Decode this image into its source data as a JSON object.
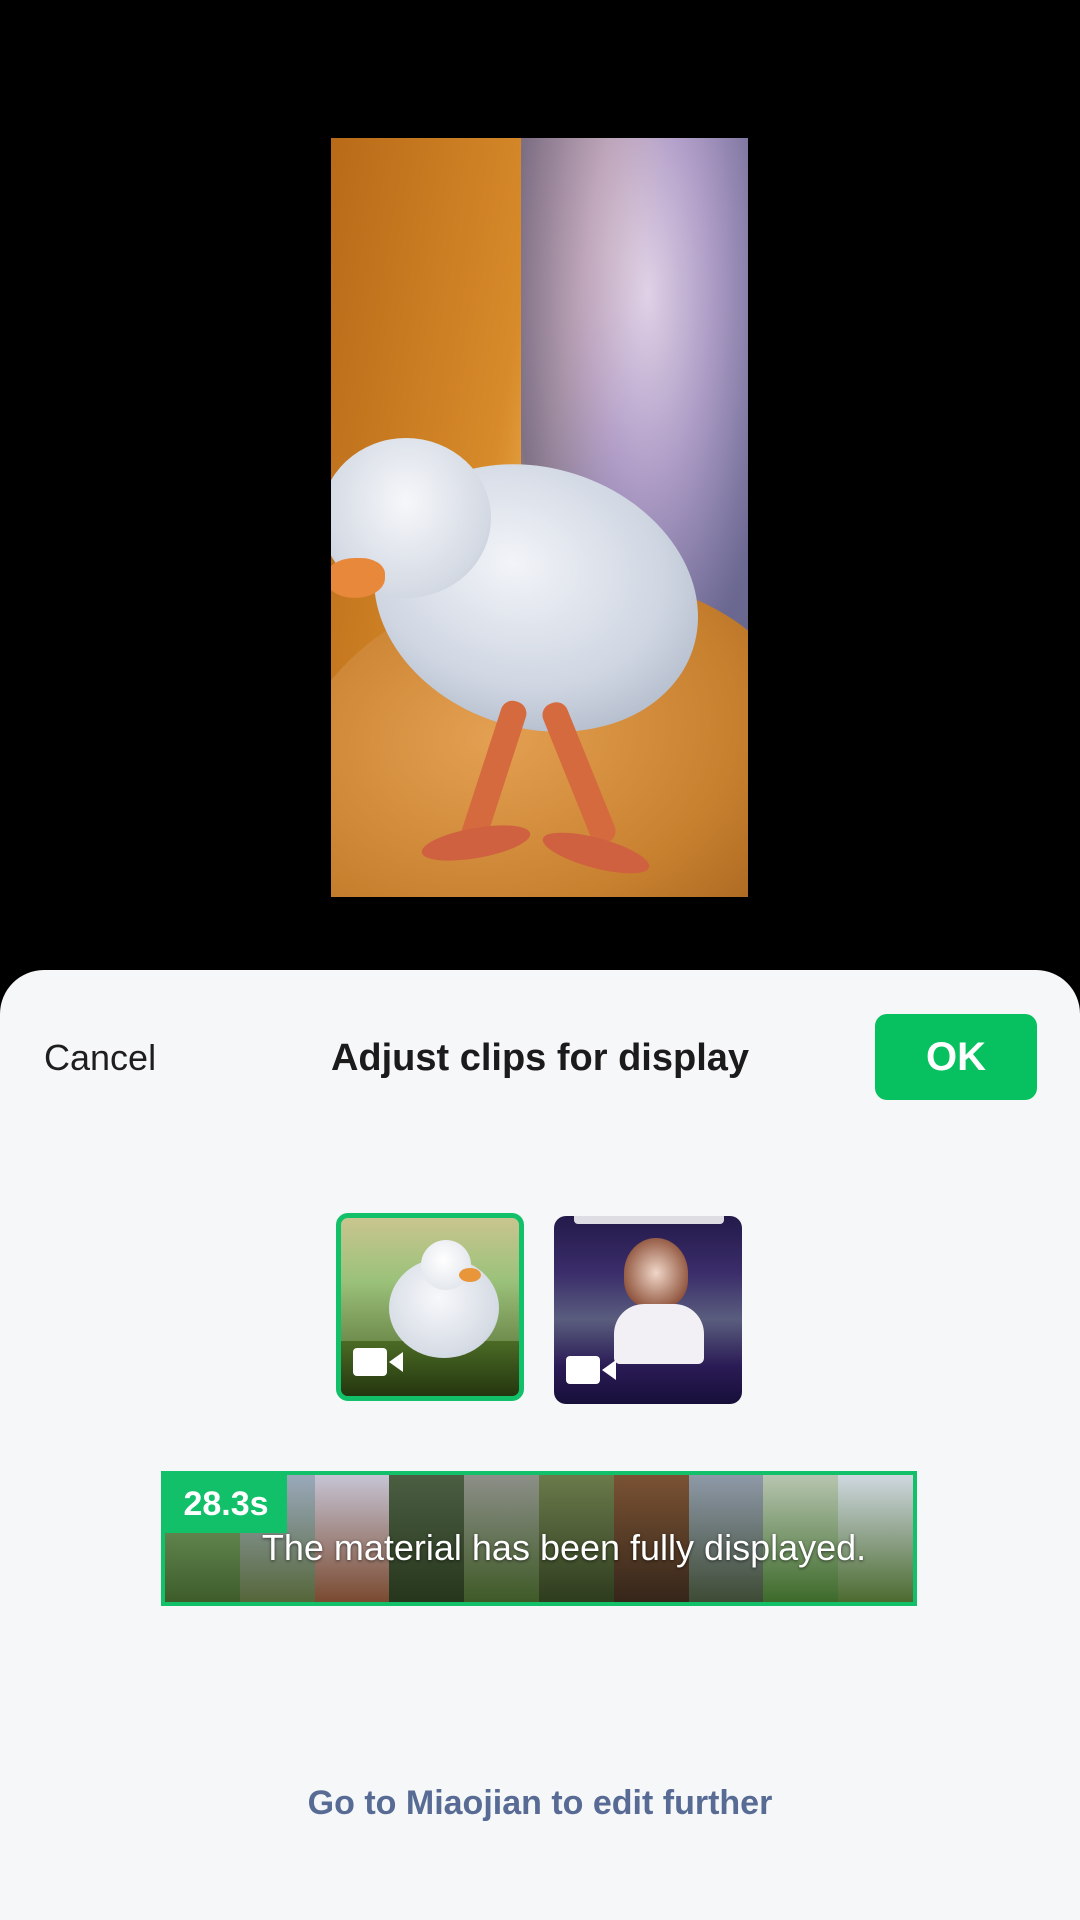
{
  "header": {
    "cancel_label": "Cancel",
    "title": "Adjust clips for display",
    "ok_label": "OK"
  },
  "clips": [
    {
      "type": "video",
      "selected": true,
      "icon": "video-camera-icon"
    },
    {
      "type": "video",
      "selected": false,
      "icon": "video-camera-icon"
    }
  ],
  "timeline": {
    "duration": "28.3s",
    "message": "The material has been fully displayed."
  },
  "footer": {
    "edit_link": "Go to Miaojian to edit further"
  },
  "colors": {
    "accent": "#07c160",
    "link": "#576b95",
    "sheet_bg": "#f6f7f8"
  }
}
